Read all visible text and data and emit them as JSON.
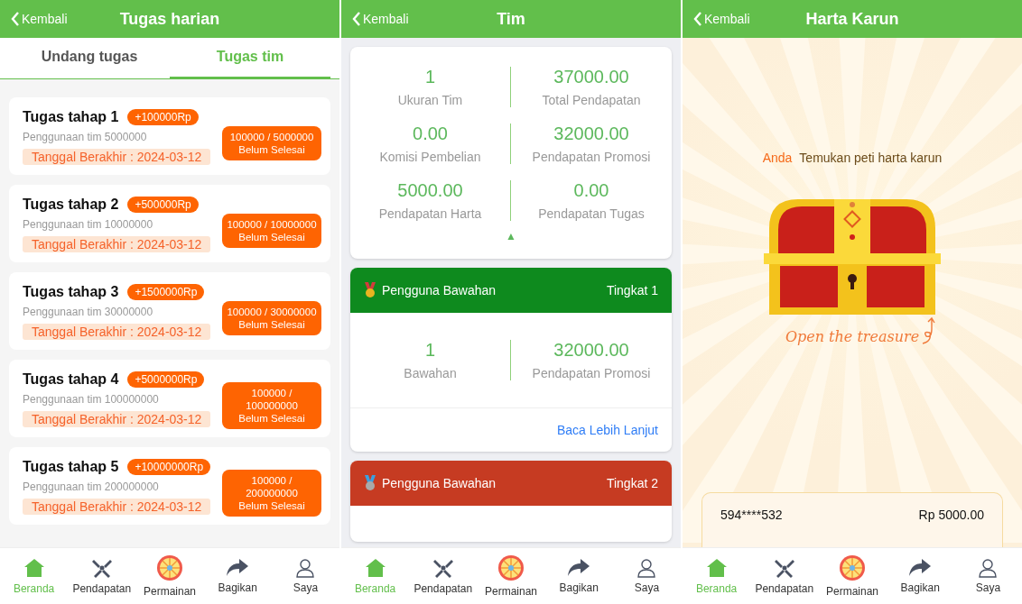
{
  "panels": [
    {
      "kind": "tasks",
      "header": {
        "back": "Kembali",
        "title": "Tugas harian"
      },
      "tabs": [
        {
          "label": "Undang tugas",
          "selected": false
        },
        {
          "label": "Tugas tim",
          "selected": true
        }
      ],
      "tasks": [
        {
          "title": "Tugas tahap 1",
          "reward": "+100000Rp",
          "usage": "Penggunaan tim 5000000",
          "deadline": "Tanggal Berakhir : 2024-03-12",
          "progress": "100000 / 5000000",
          "status": "Belum Selesai"
        },
        {
          "title": "Tugas tahap 2",
          "reward": "+500000Rp",
          "usage": "Penggunaan tim 10000000",
          "deadline": "Tanggal Berakhir : 2024-03-12",
          "progress": "100000 / 10000000",
          "status": "Belum Selesai"
        },
        {
          "title": "Tugas tahap 3",
          "reward": "+1500000Rp",
          "usage": "Penggunaan tim 30000000",
          "deadline": "Tanggal Berakhir : 2024-03-12",
          "progress": "100000 / 30000000",
          "status": "Belum Selesai"
        },
        {
          "title": "Tugas tahap 4",
          "reward": "+5000000Rp",
          "usage": "Penggunaan tim 100000000",
          "deadline": "Tanggal Berakhir : 2024-03-12",
          "progress": "100000 / 100000000",
          "status": "Belum Selesai"
        },
        {
          "title": "Tugas tahap 5",
          "reward": "+10000000Rp",
          "usage": "Penggunaan tim 200000000",
          "deadline": "Tanggal Berakhir : 2024-03-12",
          "progress": "100000 / 200000000",
          "status": "Belum Selesai"
        }
      ],
      "nav": [
        {
          "label": "Beranda",
          "selected": true
        },
        {
          "label": "Pendapatan",
          "selected": false
        },
        {
          "label": "Permainan",
          "selected": false
        },
        {
          "label": "Bagikan",
          "selected": false
        },
        {
          "label": "Saya",
          "selected": false
        }
      ]
    },
    {
      "kind": "team",
      "header": {
        "back": "Kembali",
        "title": "Tim"
      },
      "stats": [
        {
          "value": "1",
          "label": "Ukuran Tim"
        },
        {
          "value": "37000.00",
          "label": "Total Pendapatan"
        },
        {
          "value": "0.00",
          "label": "Komisi Pembelian"
        },
        {
          "value": "32000.00",
          "label": "Pendapatan Promosi"
        },
        {
          "value": "5000.00",
          "label": "Pendapatan Harta"
        },
        {
          "value": "0.00",
          "label": "Pendapatan Tugas"
        }
      ],
      "collapse": "▲",
      "levels": [
        {
          "title": "Pengguna Bawahan",
          "level": "Tingkat 1",
          "color": "#0e8a1e",
          "stats": [
            {
              "value": "1",
              "label": "Bawahan"
            },
            {
              "value": "32000.00",
              "label": "Pendapatan Promosi"
            }
          ],
          "link": "Baca Lebih Lanjut"
        },
        {
          "title": "Pengguna Bawahan",
          "level": "Tingkat 2",
          "color": "#c63b22"
        }
      ],
      "nav": [
        {
          "label": "Beranda",
          "selected": true
        },
        {
          "label": "Pendapatan",
          "selected": false
        },
        {
          "label": "Permainan",
          "selected": false
        },
        {
          "label": "Bagikan",
          "selected": false
        },
        {
          "label": "Saya",
          "selected": false
        }
      ]
    },
    {
      "kind": "treasure",
      "header": {
        "back": "Kembali",
        "title": "Harta Karun"
      },
      "prompt_name": "Anda",
      "prompt": "Temukan peti harta karun",
      "open_label": "Open the treasure",
      "records": [
        {
          "account": "594****532",
          "amount": "Rp 5000.00"
        }
      ],
      "nav": [
        {
          "label": "Beranda",
          "selected": true
        },
        {
          "label": "Pendapatan",
          "selected": false
        },
        {
          "label": "Permainan",
          "selected": false
        },
        {
          "label": "Bagikan",
          "selected": false
        },
        {
          "label": "Saya",
          "selected": false
        }
      ]
    }
  ]
}
